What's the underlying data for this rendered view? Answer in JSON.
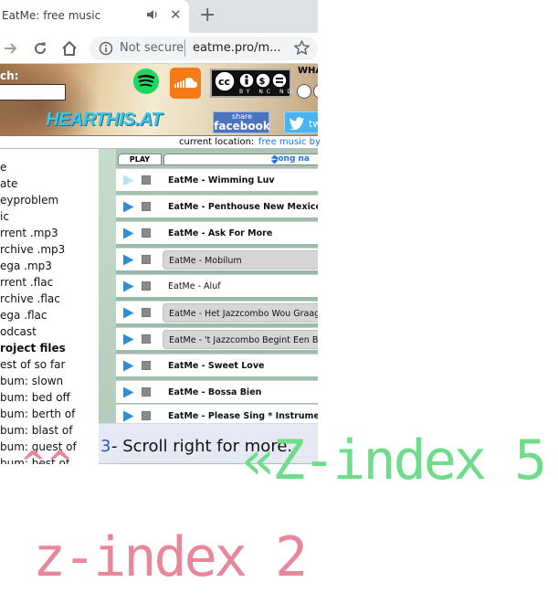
{
  "browser": {
    "tab_title": "EatMe: free music",
    "new_tab_symbol": "+",
    "close_symbol": "✕",
    "url_security": "Not secure",
    "url": "eatme.pro/m..."
  },
  "header": {
    "search_label": "ch:",
    "search_value": "",
    "what_label": "WHA",
    "hearthis_logo": "HEARTHIS.AT",
    "facebook_share_small": "share",
    "facebook_share_big": "facebook",
    "twitter_share": "tw",
    "cc_badge_text": "BY NC ND"
  },
  "location": {
    "label": "current location:",
    "link": "free music by"
  },
  "sidebar": {
    "items": [
      "e",
      "ate",
      "eyproblem",
      "ic",
      "rrent .mp3",
      "rchive .mp3",
      "ega .mp3",
      "rrent .flac",
      "rchive .flac",
      "ega .flac",
      "odcast",
      "roject files",
      "est of so far",
      "bum: slown",
      "bum: bed off",
      "bum: berth of",
      "bum: blast of",
      "bum: guest of",
      "bum: best of"
    ]
  },
  "playlist": {
    "play_header": "PLAY",
    "songname_header": "song na",
    "songs": [
      "EatMe - Wimming Luv",
      "EatMe - Penthouse New Mexico",
      "EatMe - Ask For More",
      "EatMe - Mobilum",
      "EatMe - Aluf",
      "EatMe - Het Jazzcombo Wou Graag Hard",
      "EatMe - 't Jazzcombo Begint Een Beetje",
      "EatMe - Sweet Love",
      "EatMe - Bossa Bien",
      "EatMe - Please Sing * Instrumental"
    ],
    "scroll_tip_num": "3",
    "scroll_tip_text": "- Scroll right for more."
  },
  "annotations": {
    "carets": "^^",
    "zindex5": "«Z-index 5",
    "zindex2": "z-index 2"
  },
  "colors": {
    "annotation_green": "#6fdc8c",
    "annotation_pink": "#e8879a",
    "link_blue": "#1a73e8",
    "play_blue": "#2a8fd6"
  }
}
